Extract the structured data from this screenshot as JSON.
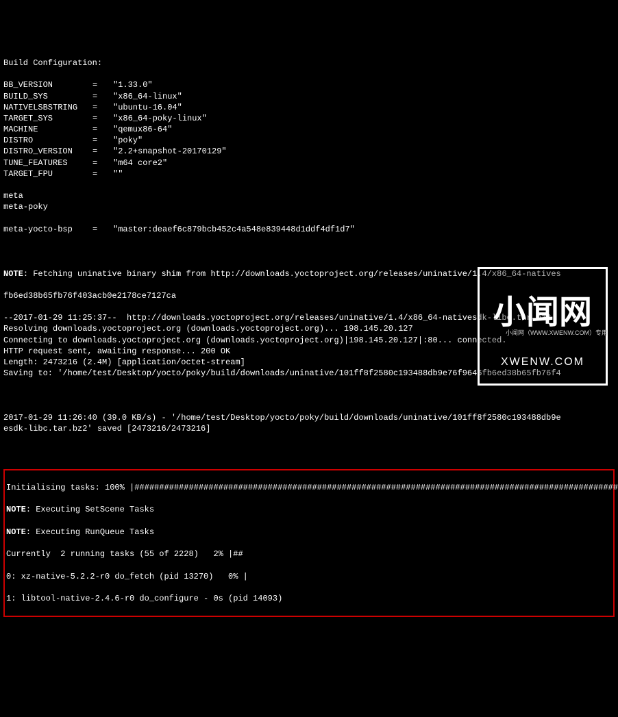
{
  "header": "Build Configuration:",
  "config": [
    {
      "key": "BB_VERSION",
      "val": "\"1.33.0\""
    },
    {
      "key": "BUILD_SYS",
      "val": "\"x86_64-linux\""
    },
    {
      "key": "NATIVELSBSTRING",
      "val": "\"ubuntu-16.04\""
    },
    {
      "key": "TARGET_SYS",
      "val": "\"x86_64-poky-linux\""
    },
    {
      "key": "MACHINE",
      "val": "\"qemux86-64\""
    },
    {
      "key": "DISTRO",
      "val": "\"poky\""
    },
    {
      "key": "DISTRO_VERSION",
      "val": "\"2.2+snapshot-20170129\""
    },
    {
      "key": "TUNE_FEATURES",
      "val": "\"m64 core2\""
    },
    {
      "key": "TARGET_FPU",
      "val": "\"\""
    }
  ],
  "meta_lines": [
    "meta",
    "meta-poky"
  ],
  "meta_yocto": {
    "key": "meta-yocto-bsp",
    "val": "\"master:deaef6c879bcb452c4a548e839448d1ddf4df1d7\""
  },
  "note_prefix": "NOTE",
  "fetch_note": ": Fetching uninative binary shim from http://downloads.yoctoproject.org/releases/uninative/1.4/x86_64-natives",
  "fetch_note2": "fb6ed38b65fb76f403acb0e2178ce7127ca",
  "wget": [
    "--2017-01-29 11:25:37--  http://downloads.yoctoproject.org/releases/uninative/1.4/x86_64-nativesdk-libc.tar.bz2",
    "Resolving downloads.yoctoproject.org (downloads.yoctoproject.org)... 198.145.20.127",
    "Connecting to downloads.yoctoproject.org (downloads.yoctoproject.org)|198.145.20.127|:80... connected.",
    "HTTP request sent, awaiting response... 200 OK",
    "Length: 2473216 (2.4M) [application/octet-stream]",
    "Saving to: '/home/test/Desktop/yocto/poky/build/downloads/uninative/101ff8f2580c193488db9e76f9646fb6ed38b65fb76f4"
  ],
  "saved": [
    "2017-01-29 11:26:40 (39.0 KB/s) - '/home/test/Desktop/yocto/poky/build/downloads/uninative/101ff8f2580c193488db9e",
    "esdk-libc.tar.bz2' saved [2473216/2473216]"
  ],
  "tasks": {
    "init": "Initialising tasks: 100% |############################################################################################################",
    "note1_prefix": "NOTE",
    "note1": ": Executing SetScene Tasks",
    "note2_prefix": "NOTE",
    "note2": ": Executing RunQueue Tasks",
    "current": "Currently  2 running tasks (55 of 2228)   2% |##",
    "t0": "0: xz-native-5.2.2-r0 do_fetch (pid 13270)   0% |",
    "t1": "1: libtool-native-2.4.6-r0 do_configure - 0s (pid 14093)"
  },
  "watermark": {
    "cn": "小闻网",
    "en": "XWENW.COM",
    "sub": "小闻网（WWW.XWENW.COM）专用"
  }
}
